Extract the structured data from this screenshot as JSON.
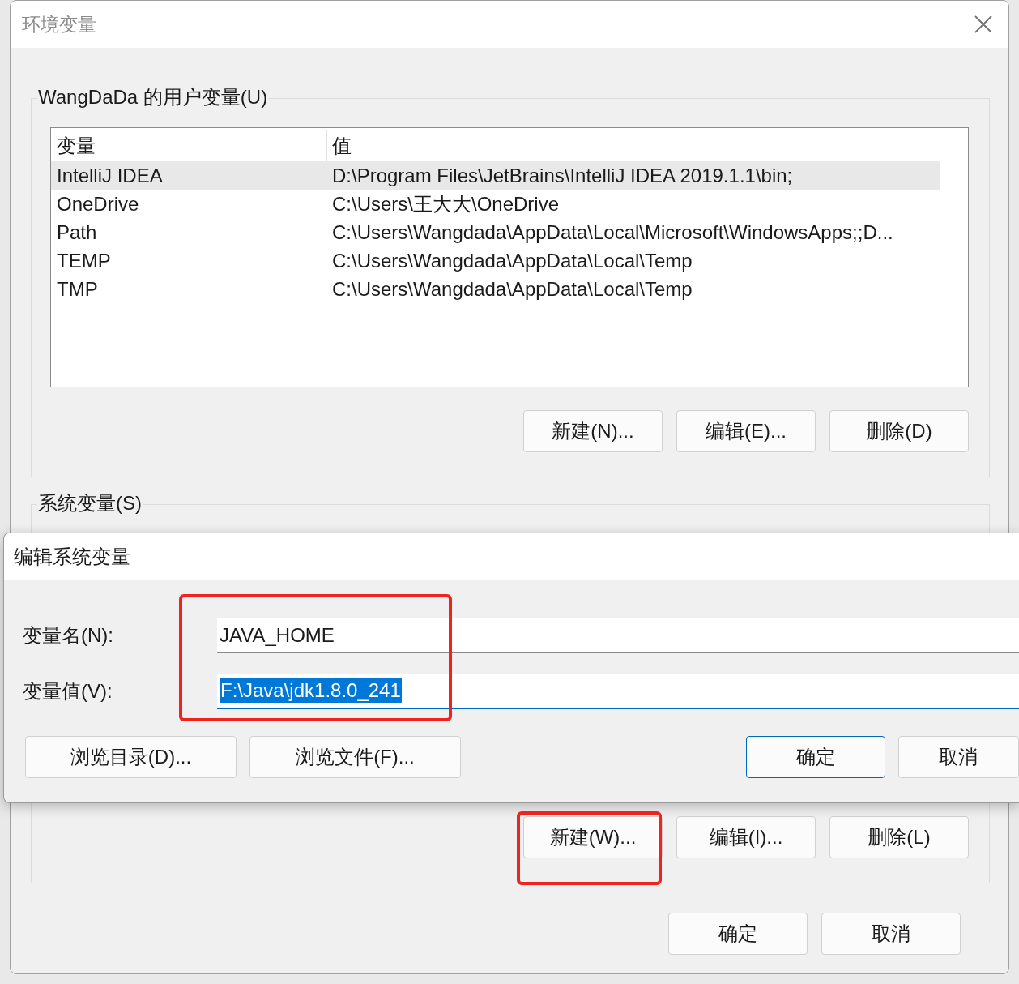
{
  "window": {
    "title": "环境变量"
  },
  "user_variables": {
    "label": "WangDaDa 的用户变量(U)",
    "columns": [
      "变量",
      "值"
    ],
    "rows": [
      {
        "name": "IntelliJ IDEA",
        "value": "D:\\Program Files\\JetBrains\\IntelliJ IDEA 2019.1.1\\bin;",
        "selected": true
      },
      {
        "name": "OneDrive",
        "value": "C:\\Users\\王大大\\OneDrive",
        "selected": false
      },
      {
        "name": "Path",
        "value": "C:\\Users\\Wangdada\\AppData\\Local\\Microsoft\\WindowsApps;;D...",
        "selected": false
      },
      {
        "name": "TEMP",
        "value": "C:\\Users\\Wangdada\\AppData\\Local\\Temp",
        "selected": false
      },
      {
        "name": "TMP",
        "value": "C:\\Users\\Wangdada\\AppData\\Local\\Temp",
        "selected": false
      }
    ],
    "buttons": [
      "新建(N)...",
      "编辑(E)...",
      "删除(D)"
    ]
  },
  "system_variables": {
    "label": "系统变量(S)",
    "buttons": [
      "新建(W)...",
      "编辑(I)...",
      "删除(L)"
    ]
  },
  "buttons": [
    "确定",
    "取消"
  ],
  "edit_dialog": {
    "title": "编辑系统变量",
    "fields": [
      {
        "label": "变量名(N):",
        "value": "JAVA_HOME",
        "focused": false
      },
      {
        "label": "变量值(V):",
        "value": "F:\\Java\\jdk1.8.0_241",
        "focused": true
      }
    ],
    "buttons": [
      {
        "label": "浏览目录(D)...",
        "default": false
      },
      {
        "label": "浏览文件(F)...",
        "default": false
      },
      {
        "label": "确定",
        "default": true
      },
      {
        "label": "取消",
        "default": false
      }
    ]
  }
}
